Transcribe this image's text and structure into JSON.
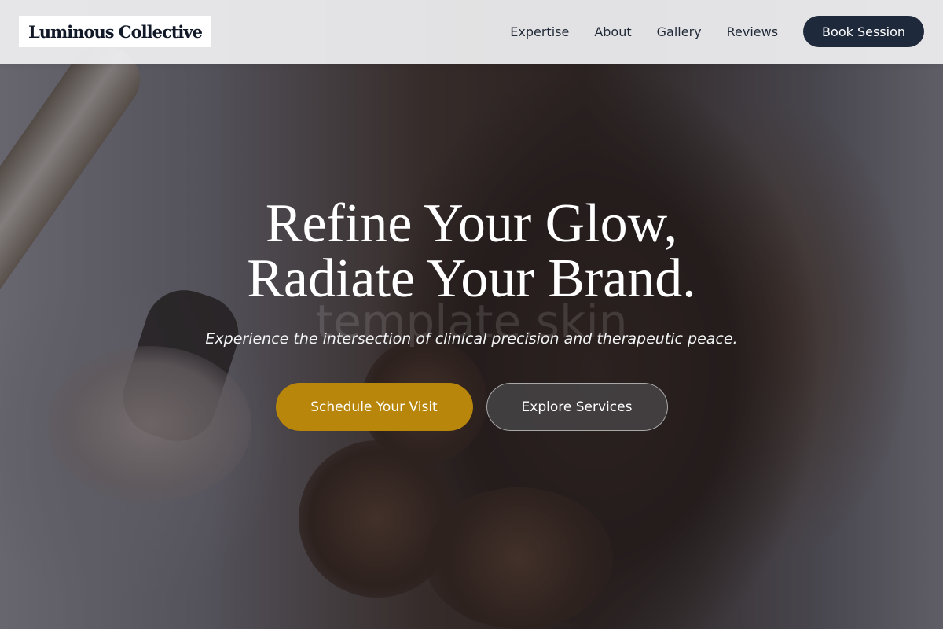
{
  "header": {
    "logo_text": "Luminous Collective",
    "nav": [
      {
        "label": "Expertise"
      },
      {
        "label": "About"
      },
      {
        "label": "Gallery"
      },
      {
        "label": "Reviews"
      }
    ],
    "book_label": "Book Session"
  },
  "hero": {
    "title_line1": "Refine Your Glow,",
    "title_line2": "Radiate Your Brand.",
    "watermark": "template.skin",
    "subtitle": "Experience the intersection of clinical precision and therapeutic peace.",
    "primary_cta": "Schedule Your Visit",
    "secondary_cta": "Explore Services",
    "background_image": "woman-hair-curling"
  },
  "colors": {
    "primary_cta": "#b8860b",
    "book_button": "#1e293b",
    "header_bg": "#f0f0f2",
    "text_dark": "#1f2937"
  }
}
